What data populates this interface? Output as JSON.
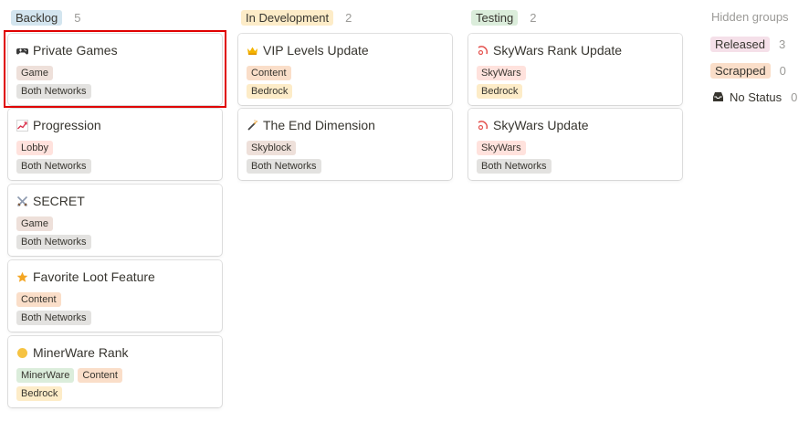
{
  "columns": [
    {
      "group": "Backlog",
      "count": "5",
      "color": "c-blue",
      "cards": [
        {
          "title": "Private Games",
          "icon": "game-controller-icon",
          "tags": [
            [
              "Game"
            ],
            [
              "Both Networks"
            ]
          ],
          "tagColors": [
            [
              "c-brown"
            ],
            [
              "c-gray"
            ]
          ]
        },
        {
          "title": "Progression",
          "icon": "chart-increasing-icon",
          "tags": [
            [
              "Lobby"
            ],
            [
              "Both Networks"
            ]
          ],
          "tagColors": [
            [
              "c-red"
            ],
            [
              "c-gray"
            ]
          ]
        },
        {
          "title": "SECRET",
          "icon": "crossed-swords-icon",
          "tags": [
            [
              "Game"
            ],
            [
              "Both Networks"
            ]
          ],
          "tagColors": [
            [
              "c-brown"
            ],
            [
              "c-gray"
            ]
          ]
        },
        {
          "title": "Favorite Loot Feature",
          "icon": "star-icon",
          "tags": [
            [
              "Content"
            ],
            [
              "Both Networks"
            ]
          ],
          "tagColors": [
            [
              "c-orange"
            ],
            [
              "c-gray"
            ]
          ]
        },
        {
          "title": "MinerWare Rank",
          "icon": "yellow-circle-icon",
          "tags": [
            [
              "MinerWare",
              "Content"
            ],
            [
              "Bedrock"
            ]
          ],
          "tagColors": [
            [
              "c-green",
              "c-orange"
            ],
            [
              "c-yellow"
            ]
          ]
        }
      ]
    },
    {
      "group": "In Development",
      "count": "2",
      "color": "c-yellow",
      "cards": [
        {
          "title": "VIP Levels Update",
          "icon": "crown-icon",
          "tags": [
            [
              "Content"
            ],
            [
              "Bedrock"
            ]
          ],
          "tagColors": [
            [
              "c-orange"
            ],
            [
              "c-yellow"
            ]
          ]
        },
        {
          "title": "The End Dimension",
          "icon": "magic-wand-icon",
          "tags": [
            [
              "Skyblock"
            ],
            [
              "Both Networks"
            ]
          ],
          "tagColors": [
            [
              "c-brown"
            ],
            [
              "c-gray"
            ]
          ]
        }
      ]
    },
    {
      "group": "Testing",
      "count": "2",
      "color": "c-green",
      "cards": [
        {
          "title": "SkyWars Rank Update",
          "icon": "ringed-planet-icon",
          "tags": [
            [
              "SkyWars"
            ],
            [
              "Bedrock"
            ]
          ],
          "tagColors": [
            [
              "c-red"
            ],
            [
              "c-yellow"
            ]
          ]
        },
        {
          "title": "SkyWars Update",
          "icon": "ringed-planet-icon",
          "tags": [
            [
              "SkyWars"
            ],
            [
              "Both Networks"
            ]
          ],
          "tagColors": [
            [
              "c-red"
            ],
            [
              "c-gray"
            ]
          ]
        }
      ]
    }
  ],
  "hidden": {
    "title": "Hidden groups",
    "groups": [
      {
        "label": "Released",
        "count": "3",
        "color": "c-pink"
      },
      {
        "label": "Scrapped",
        "count": "0",
        "color": "c-orange"
      }
    ],
    "no_status": {
      "label": "No Status",
      "count": "0"
    }
  }
}
